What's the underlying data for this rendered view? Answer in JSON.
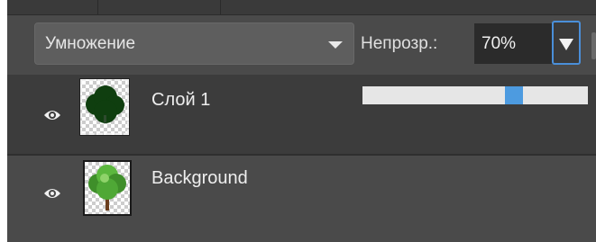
{
  "blend_mode": {
    "selected": "Умножение"
  },
  "opacity": {
    "label": "Непрозр.:",
    "value": "70%",
    "slider_fraction": 0.67
  },
  "layers": [
    {
      "name": "Слой 1",
      "visible": true,
      "selected": true,
      "icon": "eye-icon"
    },
    {
      "name": "Background",
      "visible": true,
      "selected": false,
      "icon": "eye-icon"
    }
  ],
  "colors": {
    "accent": "#4d9be0",
    "panel_bg": "#4a4a4a",
    "selected_row_bg": "#3c3c3c",
    "dark_tree": "#0f3e0f",
    "light_tree": "#4fa836"
  }
}
